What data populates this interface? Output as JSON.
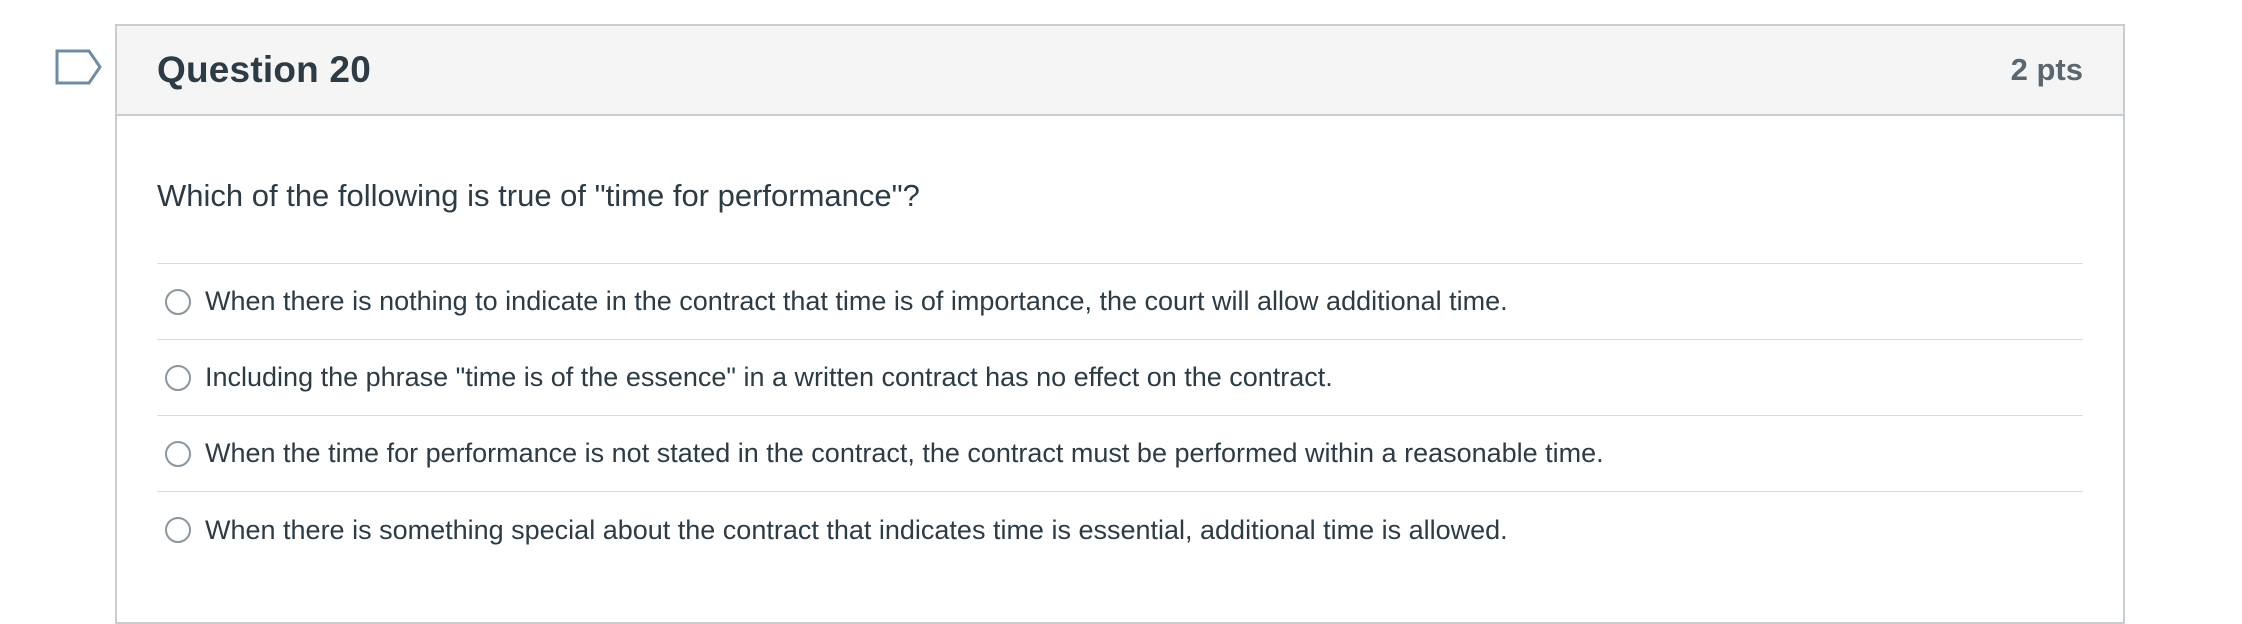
{
  "question": {
    "title": "Question 20",
    "points": "2 pts",
    "text": "Which of the following is true of \"time for performance\"?",
    "answers": [
      {
        "label": "When there is nothing to indicate in the contract that time is of importance, the court will allow additional time."
      },
      {
        "label": "Including the phrase \"time is of the essence\" in a written contract has no effect on the contract."
      },
      {
        "label": "When the time for performance is not stated in the contract, the contract must be performed within a reasonable time."
      },
      {
        "label": "When there is something special about the contract that indicates time is essential, additional time is allowed."
      }
    ]
  },
  "icons": {
    "flag": "bookmark-flag-icon",
    "radio": "radio-unchecked"
  },
  "colors": {
    "text": "#2d3b45",
    "points": "#5a6670",
    "header_bg": "#f5f5f5",
    "border": "#c7cdd1",
    "flag_stroke": "#6e8da5"
  }
}
